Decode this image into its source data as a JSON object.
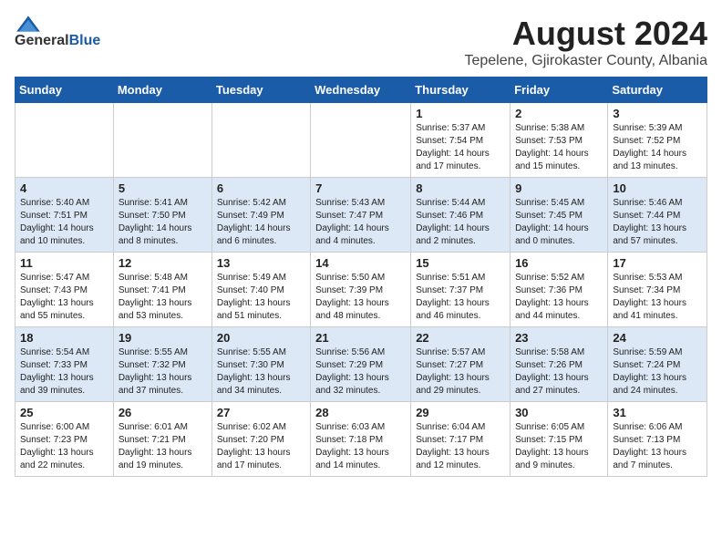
{
  "header": {
    "logo_general": "General",
    "logo_blue": "Blue",
    "month_year": "August 2024",
    "location": "Tepelene, Gjirokaster County, Albania"
  },
  "days_of_week": [
    "Sunday",
    "Monday",
    "Tuesday",
    "Wednesday",
    "Thursday",
    "Friday",
    "Saturday"
  ],
  "weeks": [
    [
      {
        "day": "",
        "info": ""
      },
      {
        "day": "",
        "info": ""
      },
      {
        "day": "",
        "info": ""
      },
      {
        "day": "",
        "info": ""
      },
      {
        "day": "1",
        "info": "Sunrise: 5:37 AM\nSunset: 7:54 PM\nDaylight: 14 hours\nand 17 minutes."
      },
      {
        "day": "2",
        "info": "Sunrise: 5:38 AM\nSunset: 7:53 PM\nDaylight: 14 hours\nand 15 minutes."
      },
      {
        "day": "3",
        "info": "Sunrise: 5:39 AM\nSunset: 7:52 PM\nDaylight: 14 hours\nand 13 minutes."
      }
    ],
    [
      {
        "day": "4",
        "info": "Sunrise: 5:40 AM\nSunset: 7:51 PM\nDaylight: 14 hours\nand 10 minutes."
      },
      {
        "day": "5",
        "info": "Sunrise: 5:41 AM\nSunset: 7:50 PM\nDaylight: 14 hours\nand 8 minutes."
      },
      {
        "day": "6",
        "info": "Sunrise: 5:42 AM\nSunset: 7:49 PM\nDaylight: 14 hours\nand 6 minutes."
      },
      {
        "day": "7",
        "info": "Sunrise: 5:43 AM\nSunset: 7:47 PM\nDaylight: 14 hours\nand 4 minutes."
      },
      {
        "day": "8",
        "info": "Sunrise: 5:44 AM\nSunset: 7:46 PM\nDaylight: 14 hours\nand 2 minutes."
      },
      {
        "day": "9",
        "info": "Sunrise: 5:45 AM\nSunset: 7:45 PM\nDaylight: 14 hours\nand 0 minutes."
      },
      {
        "day": "10",
        "info": "Sunrise: 5:46 AM\nSunset: 7:44 PM\nDaylight: 13 hours\nand 57 minutes."
      }
    ],
    [
      {
        "day": "11",
        "info": "Sunrise: 5:47 AM\nSunset: 7:43 PM\nDaylight: 13 hours\nand 55 minutes."
      },
      {
        "day": "12",
        "info": "Sunrise: 5:48 AM\nSunset: 7:41 PM\nDaylight: 13 hours\nand 53 minutes."
      },
      {
        "day": "13",
        "info": "Sunrise: 5:49 AM\nSunset: 7:40 PM\nDaylight: 13 hours\nand 51 minutes."
      },
      {
        "day": "14",
        "info": "Sunrise: 5:50 AM\nSunset: 7:39 PM\nDaylight: 13 hours\nand 48 minutes."
      },
      {
        "day": "15",
        "info": "Sunrise: 5:51 AM\nSunset: 7:37 PM\nDaylight: 13 hours\nand 46 minutes."
      },
      {
        "day": "16",
        "info": "Sunrise: 5:52 AM\nSunset: 7:36 PM\nDaylight: 13 hours\nand 44 minutes."
      },
      {
        "day": "17",
        "info": "Sunrise: 5:53 AM\nSunset: 7:34 PM\nDaylight: 13 hours\nand 41 minutes."
      }
    ],
    [
      {
        "day": "18",
        "info": "Sunrise: 5:54 AM\nSunset: 7:33 PM\nDaylight: 13 hours\nand 39 minutes."
      },
      {
        "day": "19",
        "info": "Sunrise: 5:55 AM\nSunset: 7:32 PM\nDaylight: 13 hours\nand 37 minutes."
      },
      {
        "day": "20",
        "info": "Sunrise: 5:55 AM\nSunset: 7:30 PM\nDaylight: 13 hours\nand 34 minutes."
      },
      {
        "day": "21",
        "info": "Sunrise: 5:56 AM\nSunset: 7:29 PM\nDaylight: 13 hours\nand 32 minutes."
      },
      {
        "day": "22",
        "info": "Sunrise: 5:57 AM\nSunset: 7:27 PM\nDaylight: 13 hours\nand 29 minutes."
      },
      {
        "day": "23",
        "info": "Sunrise: 5:58 AM\nSunset: 7:26 PM\nDaylight: 13 hours\nand 27 minutes."
      },
      {
        "day": "24",
        "info": "Sunrise: 5:59 AM\nSunset: 7:24 PM\nDaylight: 13 hours\nand 24 minutes."
      }
    ],
    [
      {
        "day": "25",
        "info": "Sunrise: 6:00 AM\nSunset: 7:23 PM\nDaylight: 13 hours\nand 22 minutes."
      },
      {
        "day": "26",
        "info": "Sunrise: 6:01 AM\nSunset: 7:21 PM\nDaylight: 13 hours\nand 19 minutes."
      },
      {
        "day": "27",
        "info": "Sunrise: 6:02 AM\nSunset: 7:20 PM\nDaylight: 13 hours\nand 17 minutes."
      },
      {
        "day": "28",
        "info": "Sunrise: 6:03 AM\nSunset: 7:18 PM\nDaylight: 13 hours\nand 14 minutes."
      },
      {
        "day": "29",
        "info": "Sunrise: 6:04 AM\nSunset: 7:17 PM\nDaylight: 13 hours\nand 12 minutes."
      },
      {
        "day": "30",
        "info": "Sunrise: 6:05 AM\nSunset: 7:15 PM\nDaylight: 13 hours\nand 9 minutes."
      },
      {
        "day": "31",
        "info": "Sunrise: 6:06 AM\nSunset: 7:13 PM\nDaylight: 13 hours\nand 7 minutes."
      }
    ]
  ]
}
